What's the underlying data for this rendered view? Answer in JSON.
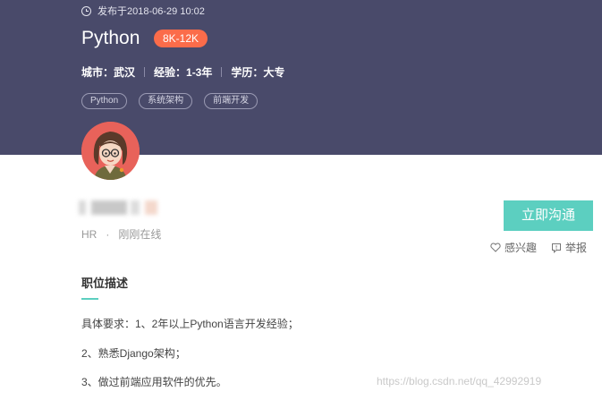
{
  "job": {
    "published": "发布于2018-06-29 10:02",
    "title": "Python",
    "salary": "8K-12K",
    "requirements": {
      "city": "城市：武汉",
      "experience": "经验：1-3年",
      "education": "学历：大专"
    },
    "tags": [
      "Python",
      "系统架构",
      "前端开发"
    ]
  },
  "recruiter": {
    "role": "HR",
    "separator": "·",
    "status": "刚刚在线"
  },
  "actions": {
    "chat_label": "立即沟通",
    "interest_label": "感兴趣",
    "report_label": "举报"
  },
  "description": {
    "title": "职位描述",
    "lines": [
      "具体要求：1、2年以上Python语言开发经验；",
      "2、熟悉Django架构；",
      "3、做过前端应用软件的优先。"
    ]
  },
  "watermark": "https://blog.csdn.net/qq_42992919",
  "colors": {
    "header_bg": "#494a6a",
    "salary_badge": "#fb6c4a",
    "accent": "#5ccfc0"
  },
  "icons": {
    "published": "clock-icon",
    "interest": "heart-icon",
    "report": "report-icon"
  }
}
